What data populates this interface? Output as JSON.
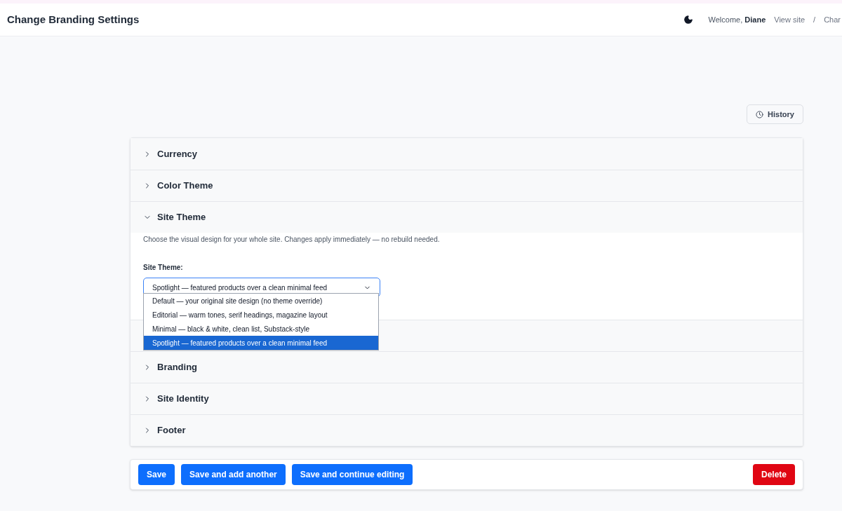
{
  "header": {
    "title": "Change Branding Settings",
    "welcome": "Welcome,",
    "user": "Diane",
    "links": [
      "View site",
      "/",
      "Char"
    ]
  },
  "history_button": "History",
  "sections": [
    {
      "title": "Currency",
      "expanded": false
    },
    {
      "title": "Color Theme",
      "expanded": false
    },
    {
      "title": "Site Theme",
      "expanded": true,
      "description": "Choose the visual design for your whole site. Changes apply immediately — no rebuild needed.",
      "field": {
        "label": "Site Theme:",
        "value": "Spotlight — featured products over a clean minimal feed",
        "open": true,
        "options": [
          {
            "label": "Default — your original site design (no theme override)",
            "selected": false
          },
          {
            "label": "Editorial — warm tones, serif headings, magazine layout",
            "selected": false
          },
          {
            "label": "Minimal — black & white, clean list, Substack-style",
            "selected": false
          },
          {
            "label": "Spotlight — featured products over a clean minimal feed",
            "selected": true
          }
        ]
      }
    },
    {
      "title": "Branding",
      "expanded": false
    },
    {
      "title": "Site Identity",
      "expanded": false
    },
    {
      "title": "Footer",
      "expanded": false
    }
  ],
  "actions": [
    {
      "label": "Save",
      "kind": "primary"
    },
    {
      "label": "Save and add another",
      "kind": "primary"
    },
    {
      "label": "Save and continue editing",
      "kind": "primary"
    },
    {
      "label": "Delete",
      "kind": "danger"
    }
  ]
}
